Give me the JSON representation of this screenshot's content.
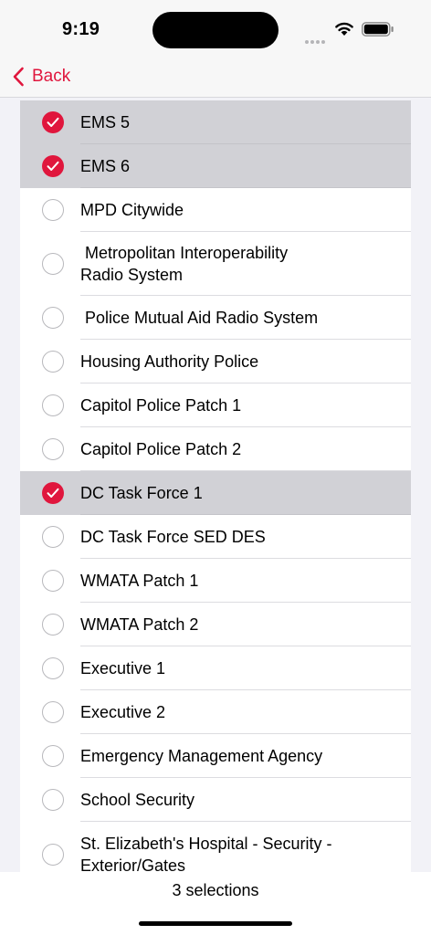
{
  "status_bar": {
    "time": "9:19"
  },
  "nav": {
    "back_label": "Back"
  },
  "accent_color": "#e0163d",
  "list": {
    "items": [
      {
        "label": "EMS 5",
        "selected": true
      },
      {
        "label": "EMS 6",
        "selected": true
      },
      {
        "label": "MPD Citywide",
        "selected": false
      },
      {
        "label": " Metropolitan Interoperability\nRadio System",
        "selected": false
      },
      {
        "label": " Police Mutual Aid Radio System",
        "selected": false
      },
      {
        "label": "Housing Authority Police",
        "selected": false
      },
      {
        "label": "Capitol Police Patch 1",
        "selected": false
      },
      {
        "label": "Capitol Police Patch 2",
        "selected": false
      },
      {
        "label": "DC Task Force 1",
        "selected": true
      },
      {
        "label": "DC Task Force SED DES",
        "selected": false
      },
      {
        "label": "WMATA Patch 1",
        "selected": false
      },
      {
        "label": "WMATA Patch 2",
        "selected": false
      },
      {
        "label": "Executive 1",
        "selected": false
      },
      {
        "label": "Executive 2",
        "selected": false
      },
      {
        "label": "Emergency Management Agency",
        "selected": false
      },
      {
        "label": "School Security",
        "selected": false
      },
      {
        "label": "St. Elizabeth's Hospital - Security -\nExterior/Gates",
        "selected": false
      }
    ]
  },
  "footer": {
    "selection_count": "3 selections"
  }
}
